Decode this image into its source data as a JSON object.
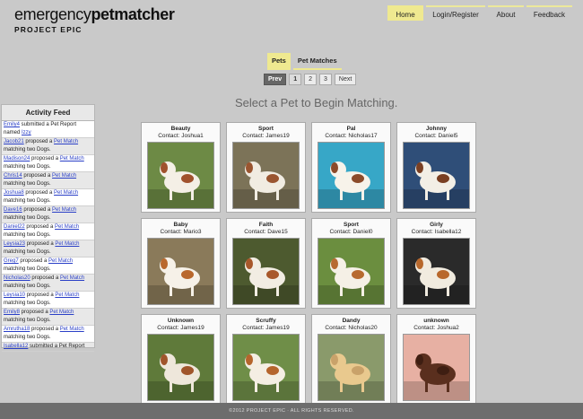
{
  "logo": {
    "part1": "emergency",
    "part2": "petmatcher",
    "sub": "PROJECT EPIC"
  },
  "nav": [
    {
      "label": "Home",
      "active": true
    },
    {
      "label": "Login/Register",
      "active": false
    },
    {
      "label": "About",
      "active": false
    },
    {
      "label": "Feedback",
      "active": false
    }
  ],
  "tabs": [
    {
      "label": "Pets",
      "active": true
    },
    {
      "label": "Pet Matches",
      "active": false
    }
  ],
  "pager": {
    "prev": "Prev",
    "pages": [
      "1",
      "2",
      "3"
    ],
    "next": "Next",
    "current": "1"
  },
  "headline": "Select a Pet to Begin Matching.",
  "feed": {
    "title": "Activity Feed",
    "items": [
      {
        "user": "Emily4",
        "pre": " submitted a Pet Report named ",
        "link": "Izzy",
        "post": ""
      },
      {
        "user": "Jacob21",
        "pre": " proposed a ",
        "link": "Pet Match",
        "post": " matching two Dogs."
      },
      {
        "user": "Madison24",
        "pre": " proposed a ",
        "link": "Pet Match",
        "post": " matching two Dogs."
      },
      {
        "user": "Chris14",
        "pre": " proposed a ",
        "link": "Pet Match",
        "post": " matching two Dogs."
      },
      {
        "user": "Joshua8",
        "pre": " proposed a ",
        "link": "Pet Match",
        "post": " matching two Dogs."
      },
      {
        "user": "Dave16",
        "pre": " proposed a ",
        "link": "Pet Match",
        "post": " matching two Dogs."
      },
      {
        "user": "Daniel22",
        "pre": " proposed a ",
        "link": "Pet Match",
        "post": " matching two Dogs."
      },
      {
        "user": "Leysia23",
        "pre": " proposed a ",
        "link": "Pet Match",
        "post": " matching two Dogs."
      },
      {
        "user": "Greg7",
        "pre": " proposed a ",
        "link": "Pet Match",
        "post": " matching two Dogs."
      },
      {
        "user": "Nicholas20",
        "pre": " proposed a ",
        "link": "Pet Match",
        "post": " matching two Dogs."
      },
      {
        "user": "Leysia10",
        "pre": " proposed a ",
        "link": "Pet Match",
        "post": " matching two Dogs."
      },
      {
        "user": "Emily8",
        "pre": " proposed a ",
        "link": "Pet Match",
        "post": " matching two Dogs."
      },
      {
        "user": "Amrutha18",
        "pre": " proposed a ",
        "link": "Pet Match",
        "post": " matching two Dogs."
      },
      {
        "user": "Isabella12",
        "pre": " submitted a Pet Report",
        "link": "",
        "post": ""
      }
    ]
  },
  "pets": [
    {
      "name": "Beauty",
      "contact": "Contact: Joshua1",
      "bg": "#6d8a45",
      "fg": "#f4efe6",
      "spot": "#a0522d"
    },
    {
      "name": "Sport",
      "contact": "Contact: James19",
      "bg": "#7c7358",
      "fg": "#f1ece2",
      "spot": "#9a5530"
    },
    {
      "name": "Pal",
      "contact": "Contact: Nicholas17",
      "bg": "#37a7c7",
      "fg": "#f7f3ea",
      "spot": "#8b4b2a"
    },
    {
      "name": "Johnny",
      "contact": "Contact: Daniel5",
      "bg": "#2f4e78",
      "fg": "#f3efe6",
      "spot": "#7a3f22"
    },
    {
      "name": "Baby",
      "contact": "Contact: Mario3",
      "bg": "#8a7a5a",
      "fg": "#f6f1e8",
      "spot": "#b9682d"
    },
    {
      "name": "Faith",
      "contact": "Contact: Dave15",
      "bg": "#4d5a2f",
      "fg": "#f2ede3",
      "spot": "#a8582b"
    },
    {
      "name": "Sport",
      "contact": "Contact: Daniel0",
      "bg": "#6b8e3f",
      "fg": "#f5f0e6",
      "spot": "#b76a30"
    },
    {
      "name": "Girly",
      "contact": "Contact: Isabella12",
      "bg": "#2a2a2a",
      "fg": "#f1ebdf",
      "spot": "#b8682c"
    },
    {
      "name": "Unknown",
      "contact": "Contact: James19",
      "bg": "#5f7a3a",
      "fg": "#eee7db",
      "spot": "#a0552b"
    },
    {
      "name": "Scruffy",
      "contact": "Contact: James19",
      "bg": "#6f8e48",
      "fg": "#f4eee3",
      "spot": "#b5652c"
    },
    {
      "name": "Dandy",
      "contact": "Contact: Nicholas20",
      "bg": "#8a9a6b",
      "fg": "#e9c98e",
      "spot": "#c9a26a"
    },
    {
      "name": "unknown",
      "contact": "Contact: Joshua2",
      "bg": "#e7b0a3",
      "fg": "#5a2f1e",
      "spot": "#3e1e12"
    }
  ],
  "footer": "©2012 PROJECT EPIC · ALL RIGHTS RESERVED."
}
